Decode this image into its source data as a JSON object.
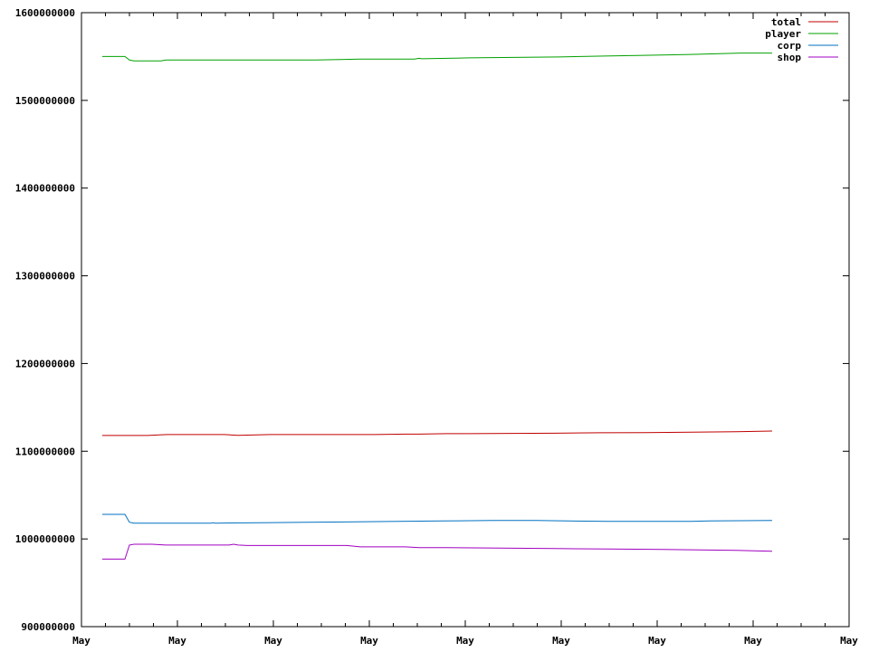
{
  "chart_data": {
    "type": "line",
    "title": "",
    "xlabel": "",
    "ylabel": "",
    "ylim": [
      900000000,
      1600000000
    ],
    "y_ticks": [
      900000000,
      1000000000,
      1100000000,
      1200000000,
      1300000000,
      1400000000,
      1500000000,
      1600000000
    ],
    "y_tick_labels": [
      "900000000",
      "1000000000",
      "1100000000",
      "1200000000",
      "1300000000",
      "1400000000",
      "1500000000",
      "1600000000"
    ],
    "x_tick_labels": [
      "May",
      "May",
      "May",
      "May",
      "May",
      "May",
      "May",
      "May",
      "May"
    ],
    "grid": false,
    "legend_position": "top-right",
    "series": [
      {
        "name": "total",
        "color": "#c00000",
        "x": [
          0,
          30,
          50,
          60,
          71,
          100,
          135,
          150,
          185,
          265,
          300,
          335,
          350,
          380,
          405,
          450,
          500,
          550,
          600,
          650,
          700,
          740
        ],
        "y": [
          1118000000,
          1118000000,
          1118000000,
          1118500000,
          1119000000,
          1119000000,
          1119000000,
          1118200000,
          1119000000,
          1119000000,
          1119000000,
          1119500000,
          1119500000,
          1120000000,
          1120000000,
          1120300000,
          1120500000,
          1121000000,
          1121200000,
          1121800000,
          1122200000,
          1123000000
        ]
      },
      {
        "name": "player",
        "color": "#00a000",
        "x": [
          0,
          25,
          30,
          35,
          50,
          65,
          70,
          100,
          150,
          200,
          235,
          285,
          345,
          350,
          353,
          405,
          455,
          505,
          555,
          605,
          655,
          705,
          740
        ],
        "y": [
          1550000000,
          1550000000,
          1546000000,
          1545000000,
          1545000000,
          1545000000,
          1546000000,
          1546000000,
          1546000000,
          1546000000,
          1546000000,
          1547000000,
          1547000000,
          1548000000,
          1547500000,
          1548500000,
          1549000000,
          1549500000,
          1550500000,
          1551500000,
          1552500000,
          1554000000,
          1554000000
        ]
      },
      {
        "name": "corp",
        "color": "#0070c0",
        "x": [
          0,
          25,
          30,
          35,
          60,
          100,
          120,
          122,
          125,
          175,
          225,
          280,
          375,
          430,
          480,
          560,
          650,
          670,
          740
        ],
        "y": [
          1028000000,
          1028000000,
          1019000000,
          1018000000,
          1018000000,
          1018000000,
          1018000000,
          1018500000,
          1018000000,
          1018500000,
          1019000000,
          1019500000,
          1020500000,
          1021000000,
          1021000000,
          1020000000,
          1020000000,
          1020500000,
          1021000000
        ]
      },
      {
        "name": "shop",
        "color": "#a000c0",
        "x": [
          0,
          25,
          30,
          35,
          55,
          70,
          100,
          140,
          145,
          150,
          160,
          200,
          270,
          285,
          300,
          335,
          350,
          380,
          440,
          500,
          560,
          620,
          700,
          720,
          740
        ],
        "y": [
          977000000,
          977000000,
          993000000,
          994000000,
          994000000,
          993000000,
          993000000,
          993000000,
          994000000,
          993000000,
          992500000,
          992500000,
          992500000,
          991000000,
          991000000,
          991000000,
          990000000,
          990000000,
          989500000,
          989000000,
          988500000,
          988000000,
          987000000,
          986500000,
          986000000
        ]
      }
    ]
  }
}
